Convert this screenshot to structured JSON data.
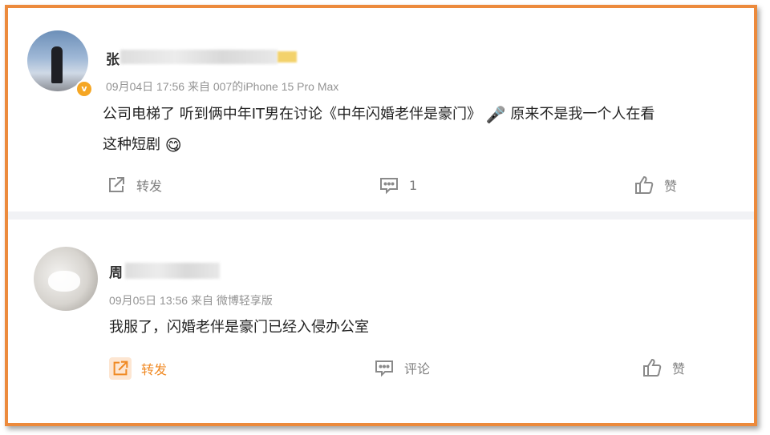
{
  "posts": [
    {
      "username_visible": "张",
      "meta": "09月04日 17:56  来自 007的iPhone 15 Pro Max",
      "content_line1": "公司电梯了 听到俩中年IT男在讨论《中年闪婚老伴是豪门》",
      "content_mid": "原来不是我一个人在看",
      "content_line2": "这种短剧",
      "emoji_1": "🎤",
      "emoji_2": "😋",
      "actions": {
        "repost_label": "转发",
        "comment_label": "1",
        "like_label": "赞"
      }
    },
    {
      "username_visible": "周",
      "meta": "09月05日 13:56  来自 微博轻享版",
      "content": "我服了，闪婚老伴是豪门已经入侵办公室",
      "actions": {
        "repost_label": "转发",
        "comment_label": "评论",
        "like_label": "赞"
      }
    }
  ],
  "colors": {
    "frame_border": "#ec8a3c",
    "accent_orange": "#f08a24",
    "meta_gray": "#939393",
    "divider": "#f1f2f5",
    "verified_badge": "#f5a623"
  },
  "icons": [
    "repost-icon",
    "comment-icon",
    "like-icon",
    "verified-badge-icon"
  ]
}
